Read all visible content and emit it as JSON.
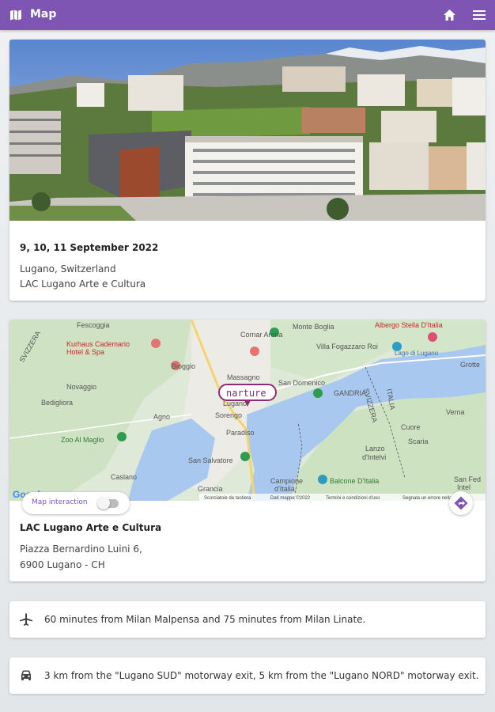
{
  "appbar": {
    "title": "Map",
    "icons": {
      "left": "map-icon",
      "home": "home-icon",
      "menu": "menu-icon"
    },
    "color": "#7e55b3"
  },
  "event": {
    "photo_desc_icon": "photo",
    "dates": "9, 10, 11 September 2022",
    "city": "Lugano, Switzerland",
    "venue_name": "LAC Lugano Arte e Cultura"
  },
  "map": {
    "toggle_label": "Map interaction",
    "toggle_on": false,
    "marker_label": "narture",
    "labels": {
      "fescoggia": "Fescoggia",
      "kurhaus": "Kurhaus Cademario",
      "kurhaus2": "Hotel & Spa",
      "cornaredo": "Cornar Arena",
      "monte_boglia": "Monte Boglia",
      "albergo": "Albergo Stella D'Italia",
      "villa": "Villa Fogazzaro Roi",
      "lago": "Lago di Lugano",
      "gandria": "GANDRIA",
      "grotte": "Grotte",
      "bioggio": "Bioggio",
      "massagno": "Massagno",
      "lugano": "Lugano",
      "san_domenico": "San Domenico",
      "novaggio": "Novaggio",
      "bedigliora": "Bedigliora",
      "agno": "Agno",
      "sorengo": "Sorengo",
      "paradiso": "Paradiso",
      "zoo": "Zoo Al Maglio",
      "san_salvatore": "San Salvatore",
      "caslano": "Caslano",
      "grancia": "Grancia",
      "campione": "Campione",
      "campione2": "d'Italia",
      "balcone": "Balcone D'Italia",
      "lanzo": "Lanzo",
      "lanzo2": "d'Intelvi",
      "verna": "Verna",
      "cuore": "Cuore",
      "scaria": "Scaria",
      "san_fedele": "San Fed",
      "san_fedele2": "Intel",
      "svizzera": "SVIZZERA",
      "italia": "ITALIA",
      "svizzera_w": "SVIZZERA",
      "google": "Google",
      "foot1": "Scorciatoie da tastiera",
      "foot2": "Dati mappe ©2022",
      "foot3": "Termini e condizioni d'uso",
      "foot4": "Segnala un errore nella mappa"
    }
  },
  "location": {
    "name": "LAC Lugano Arte e Cultura",
    "address_line1": "Piazza Bernardino Luini 6,",
    "address_line2": "6900 Lugano - CH"
  },
  "travel": {
    "plane_text": "60 minutes from Milan Malpensa and 75 minutes from Milan Linate.",
    "car_text": "3 km from the \"Lugano SUD\" motorway exit, 5 km from the \"Lugano NORD\" motorway exit."
  }
}
